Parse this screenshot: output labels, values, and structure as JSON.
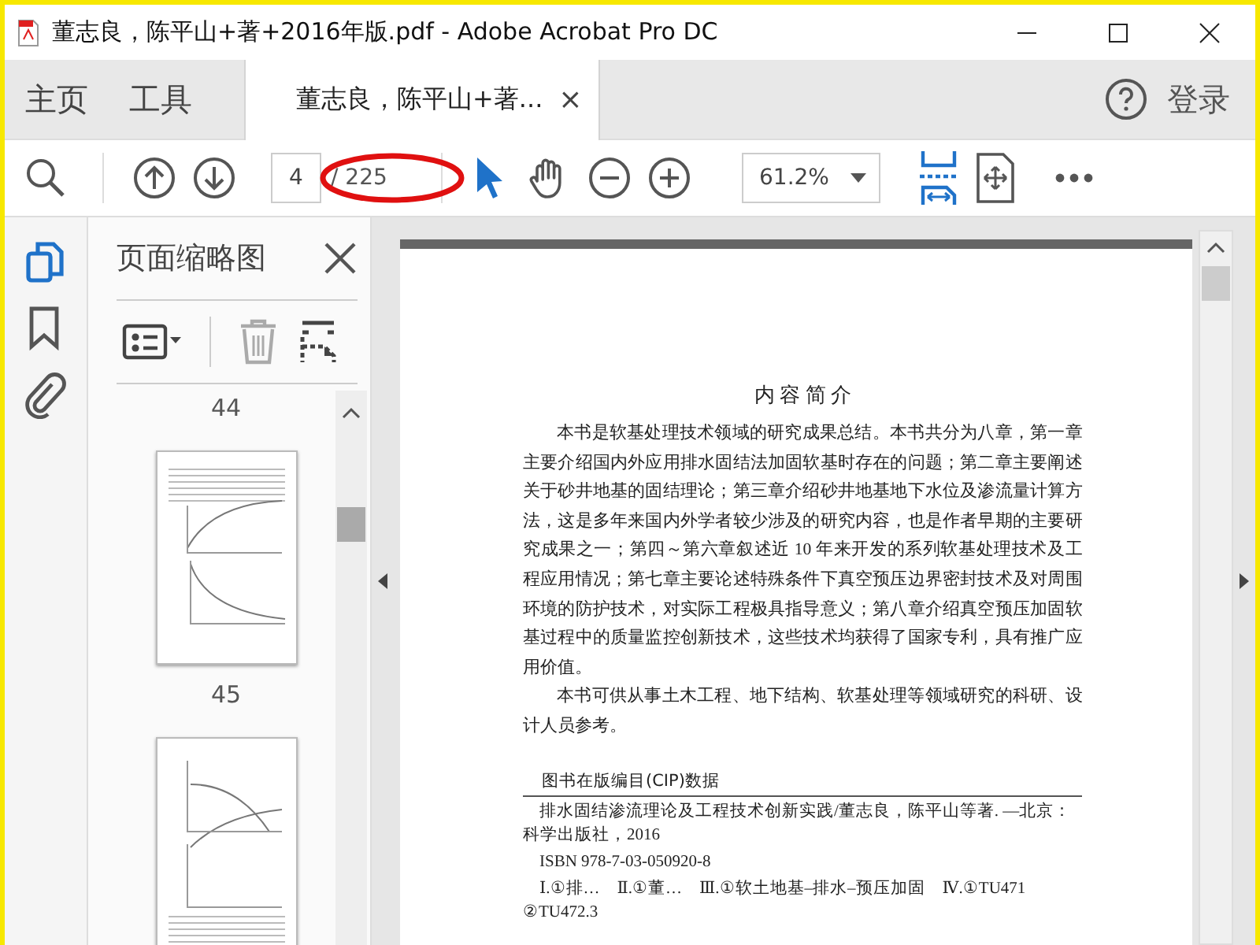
{
  "window": {
    "title": "董志良，陈平山+著+2016年版.pdf - Adobe Acrobat Pro DC"
  },
  "nav_tabs": [
    {
      "label": "主页",
      "selected": false
    },
    {
      "label": "工具",
      "selected": false
    },
    {
      "label": "董志良，陈平山+著...",
      "selected": true,
      "closable": true
    }
  ],
  "tab_close": "×",
  "sign_in": "登录",
  "toolbar": {
    "page_number": "4",
    "page_count": "/ 225",
    "zoom": "61.2%"
  },
  "side_rail": [
    {
      "kind": "pages",
      "selected": true
    },
    {
      "kind": "bookmarks",
      "selected": false
    },
    {
      "kind": "attachments",
      "selected": false
    }
  ],
  "thumbnail_panel": {
    "title": "页面缩略图",
    "page_labels": [
      "44",
      "45"
    ]
  },
  "document": {
    "heading": "内 容 简 介",
    "paragraphs": [
      "本书是软基处理技术领域的研究成果总结。本书共分为八章，第一章主要介绍国内外应用排水固结法加固软基时存在的问题；第二章主要阐述关于砂井地基的固结理论；第三章介绍砂井地基地下水位及渗流量计算方法，这是多年来国内外学者较少涉及的研究内容，也是作者早期的主要研究成果之一；第四～第六章叙述近 10 年来开发的系列软基处理技术及工程应用情况；第七章主要论述特殊条件下真空预压边界密封技术及对周围环境的防护技术，对实际工程极具指导意义；第八章介绍真空预压加固软基过程中的质量监控创新技术，这些技术均获得了国家专利，具有推广应用价值。",
      "本书可供从事土木工程、地下结构、软基处理等领域研究的科研、设计人员参考。"
    ],
    "cip": {
      "heading": "图书在版编目(CIP)数据",
      "lines": [
        "排水固结渗流理论及工程技术创新实践/董志良，陈平山等著. —北京：科学出版社，2016",
        "ISBN 978-7-03-050920-8",
        "Ⅰ.①排…　Ⅱ.①董…　Ⅲ.①软土地基–排水–预压加固　Ⅳ.①TU471 ②TU472.3"
      ]
    }
  }
}
